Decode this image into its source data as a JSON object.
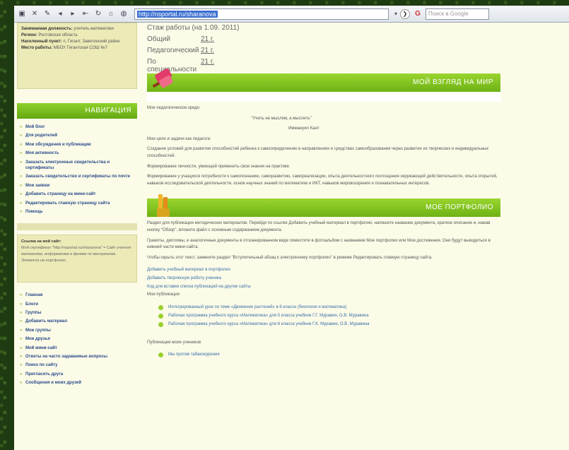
{
  "browser": {
    "address": "http://nsportal.ru/sharanova",
    "search_placeholder": "Поиск в Google"
  },
  "sidebar": {
    "userbox": {
      "l1_label": "Занимаемая должность:",
      "l1_value": "учитель математики",
      "l2_label": "Регион:",
      "l2_value": "Ростовская область",
      "l3_label": "Населенный пункт:",
      "l3_value": "п. Гигант, Заветинский район",
      "l4_label": "Место работы:",
      "l4_value": "МБОУ Гигантская СОШ №7"
    },
    "nav_title": "НАВИГАЦИЯ",
    "nav_items": [
      "Мой блог",
      "Для родителей",
      "Мои обсуждения и публикации",
      "Моя активность",
      "Заказать электронные свидетельства и сертификаты",
      "Заказать свидетельство и сертификаты по почте",
      "Мои заявки",
      "Добавить страницу на мини-сайт",
      "Редактировать главную страницу сайта",
      "Помощь"
    ],
    "info": {
      "title": "Ссылка на мой сайт:",
      "text": "Мой сертификат \"http://nsportal.ru/sharanova\" = Сайт учителя математики, информатики и физики по материалам.",
      "text2": "Элемента на портфолио"
    },
    "nav_items2": [
      "Главная",
      "Блоги",
      "Группы",
      "Добавить материал",
      "Мои группы",
      "Мои друзья",
      "Мой мини-сайт",
      "Ответы на часто задаваемые вопросы",
      "Поиск по сайту",
      "Пригласить друга",
      "Сообщения и моих друзей"
    ]
  },
  "main": {
    "stats_title": "Стаж работы (на 1.09. 2011)",
    "stats": [
      {
        "k": "Общий",
        "v": "21 г."
      },
      {
        "k": "Педагогический",
        "v": "21 г."
      },
      {
        "k": "По специальности",
        "v": "21 г."
      }
    ],
    "section1_title": "МОЙ ВЗГЛЯД НА МИР",
    "motto_label": "Мое педагогическое кредо",
    "motto": "\"Учить не мыслям, а мыслить\"",
    "motto_author": "Иммануил Кант",
    "goals_label": "Мои цели и задачи как педагога:",
    "goal1": "Создание условий для развития способностей ребенка к самоопределению в направлениях и средствах самообразования через развитие их творческих и индивидуальных способностей.",
    "goal2": "Формирование личности, умеющей применить свои знания на практике.",
    "goal3": "Формирование у учащихся потребности к самопознанию, саморазвитию, самореализации, опыта деятельностного поглощения окружающей действительности, опыта открытий, навыков исследовательской деятельности, основ научных знаний по математике и ИКТ, навыков мировоззрения и познавательных интересов.",
    "section2_title": "МОЕ ПОРТФОЛИО",
    "p1": "Раздел для публикации методических материалов. Перейдя по ссылке Добавить учебный материал в портфолио, напишите название документа, краткое описание и, нажав кнопку \"Обзор\", вложите файл с основным содержанием документа.",
    "p2": "Грамоты, дипломы, и аналогичные документы в отсканированном виде поместите в фотоальбом с названием Мое портфолио или Мои достижения. Они будут выводиться в нижней части мини-сайта.",
    "p3": "Чтобы скрыть этот текст, замените раздел \"Вступительный абзац к электронному портфолио\" в режиме Редактировать главную страницу сайта.",
    "link1": "Добавить учебный материал в портфолио",
    "link2": "Добавить творческую работу ученика",
    "link3": "Код для вставки списка публикаций на другие сайты",
    "pubs_label": "Мои публикации",
    "pubs": [
      "Интегрированный урок по теме «Движение растений» в 6 классе (биология и математика)",
      "Рабочая программа учебного курса «Математика» для 5 класса учебник Г.Г. Муравин, О.В. Муравина",
      "Рабочая программа учебного курса «Математика» для 6 класса учебник Г.К. Муравин, О.В. Муравина"
    ],
    "students_label": "Публикации моих учеников",
    "students": [
      "Мы против табакокурения"
    ]
  }
}
